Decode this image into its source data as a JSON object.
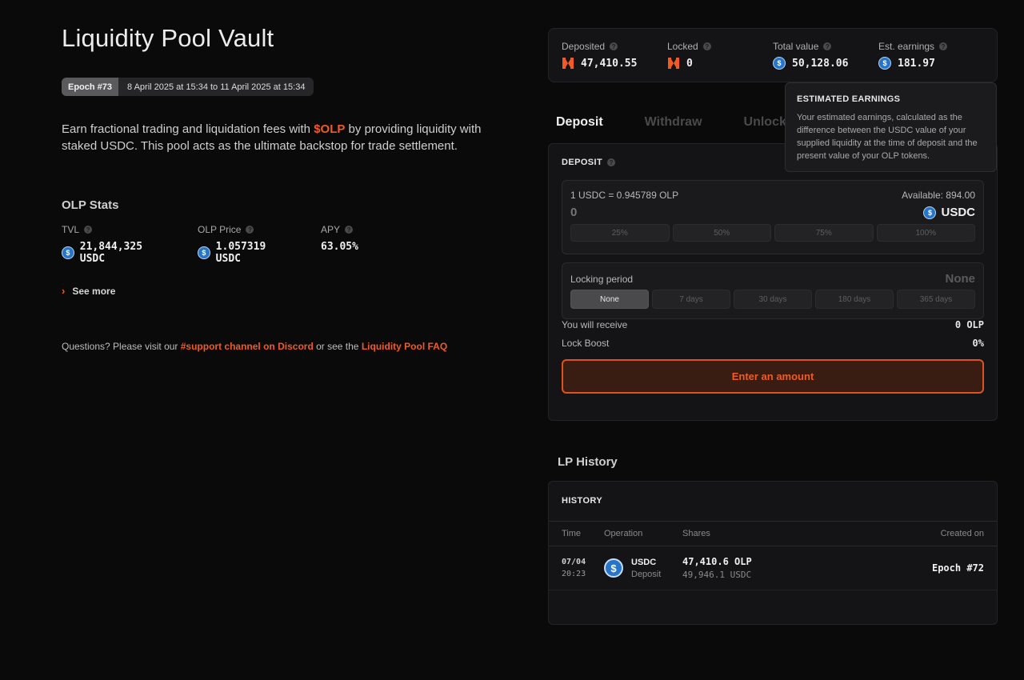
{
  "header": {
    "title": "Liquidity Pool Vault",
    "epoch_badge": "Epoch #73",
    "epoch_dates": "8 April 2025 at 15:34 to 11 April 2025 at 15:34"
  },
  "intro": {
    "before": "Earn fractional trading and liquidation fees with ",
    "token": "$OLP",
    "after": " by providing liquidity with staked USDC. This pool acts as the ultimate backstop for trade settlement."
  },
  "olp_stats": {
    "title": "OLP Stats",
    "items": [
      {
        "label": "TVL",
        "value": "21,844,325 USDC",
        "icon": "usdc-icon"
      },
      {
        "label": "OLP Price",
        "value": "1.057319 USDC",
        "icon": "usdc-icon"
      },
      {
        "label": "APY",
        "value": "63.05%"
      }
    ],
    "see_more": "See more"
  },
  "questions": {
    "before": "Questions? Please visit our ",
    "link1": "#support channel on Discord",
    "middle": " or see the ",
    "link2": "Liquidity Pool FAQ"
  },
  "summary": [
    {
      "label": "Deposited",
      "value": "47,410.55",
      "icon": "olp-icon"
    },
    {
      "label": "Locked",
      "value": "0",
      "icon": "olp-icon"
    },
    {
      "label": "Total value",
      "value": "50,128.06",
      "icon": "usdc-icon"
    },
    {
      "label": "Est. earnings",
      "value": "181.97",
      "icon": "usdc-icon"
    }
  ],
  "tooltip": {
    "title": "ESTIMATED EARNINGS",
    "body": "Your estimated earnings, calculated as the difference between the USDC value of your supplied liquidity at the time of deposit and the present value of your OLP tokens."
  },
  "tabs": [
    "Deposit",
    "Withdraw",
    "Unlock"
  ],
  "deposit": {
    "title": "DEPOSIT",
    "rate": "1 USDC = 0.945789 OLP",
    "available": "Available: 894.00",
    "amount_placeholder": "0",
    "token": "USDC",
    "percents": [
      "25%",
      "50%",
      "75%",
      "100%"
    ],
    "lock_label": "Locking period",
    "lock_value": "None",
    "lock_options": [
      "None",
      "7 days",
      "30 days",
      "180 days",
      "365 days"
    ],
    "receive_label": "You will receive",
    "receive_value": "0 OLP",
    "boost_label": "Lock Boost",
    "boost_value": "0%",
    "button": "Enter an amount"
  },
  "history": {
    "section_title": "LP History",
    "card_title": "HISTORY",
    "headers": [
      "Time",
      "Operation",
      "Shares",
      "Created on"
    ],
    "rows": [
      {
        "date": "07/04",
        "time": "20:23",
        "token": "USDC",
        "op": "Deposit",
        "shares": "47,410.6 OLP",
        "shares_usdc": "49,946.1 USDC",
        "created": "Epoch #72"
      }
    ]
  },
  "colors": {
    "accent": "#f15a24",
    "background": "#0a0a0b",
    "card": "#141416",
    "usdc": "#2775ca"
  }
}
